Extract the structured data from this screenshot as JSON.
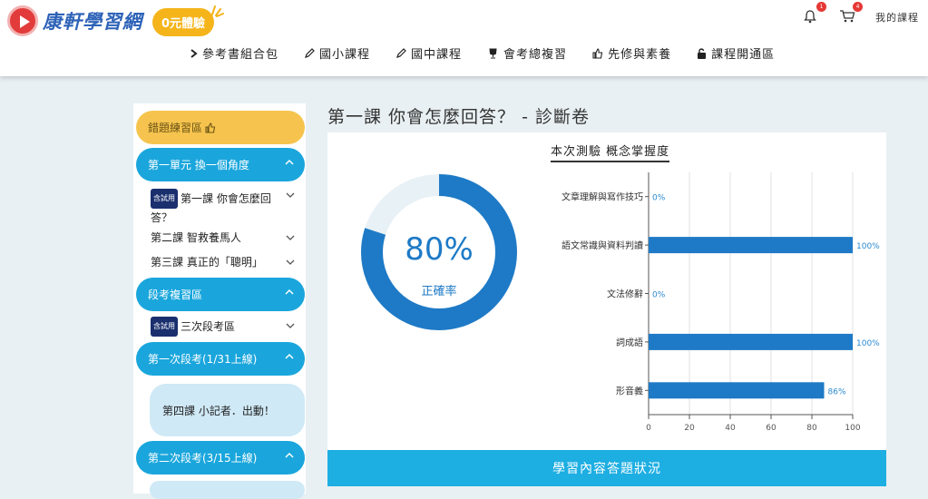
{
  "brand": {
    "name": "康軒學習網",
    "trial": "0元體驗"
  },
  "header": {
    "notif_count": "1",
    "cart_count": "4",
    "my_courses": "我的課程"
  },
  "nav": [
    "參考書組合包",
    "國小課程",
    "國中課程",
    "會考總複習",
    "先修與素養",
    "課程開通區"
  ],
  "sidebar": {
    "wrong": "錯題練習區",
    "unit1": "第一單元 換一個角度",
    "lesson1_tag": "含試用",
    "lesson1": "第一課 你會怎麼回答？",
    "lesson2": "第二課 智救養馬人",
    "lesson3": "第三課 真正的「聰明」",
    "review": "段考複習區",
    "review_tag": "含試用",
    "review_item": "三次段考區",
    "exam1": "第一次段考(1/31上線)",
    "lesson4": "第四課 小記者．出動！",
    "exam2": "第二次段考(3/15上線)"
  },
  "page_title": "第一課 你會怎麼回答？ - 診斷卷",
  "donut": {
    "value": "80%",
    "label": "正確率",
    "fraction": 0.8
  },
  "chart_title": "本次測驗 概念掌握度",
  "chart_data": {
    "type": "bar",
    "orientation": "horizontal",
    "categories": [
      "文章理解與寫作技巧",
      "語文常識與資料判讀",
      "文法修辭",
      "詞成語",
      "形音義"
    ],
    "values": [
      0,
      100,
      0,
      100,
      86
    ],
    "value_labels": [
      "0%",
      "100%",
      "0%",
      "100%",
      "86%"
    ],
    "xlim": [
      0,
      100
    ],
    "xticks": [
      "0",
      "20",
      "40",
      "60",
      "80",
      "100"
    ],
    "bar_color": "#1e7ac6",
    "grid": true
  },
  "bottom": "學習內容答題狀況"
}
